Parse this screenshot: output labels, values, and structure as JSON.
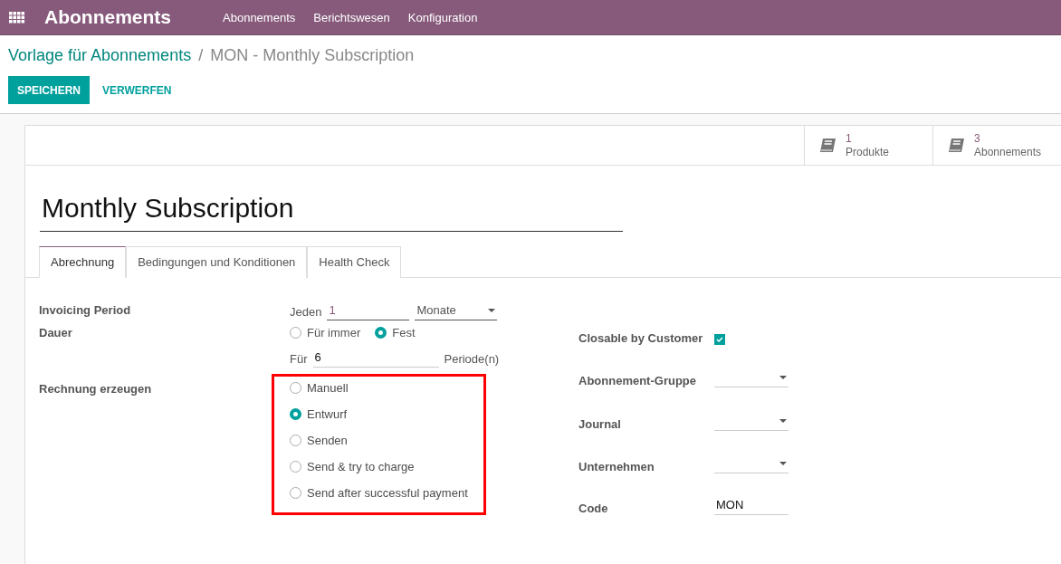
{
  "navbar": {
    "app_title": "Abonnements",
    "menu": [
      "Abonnements",
      "Berichtswesen",
      "Konfiguration"
    ]
  },
  "breadcrumb": {
    "parent": "Vorlage für Abonnements",
    "separator": "/",
    "current": "MON - Monthly Subscription"
  },
  "buttons": {
    "save": "SPEICHERN",
    "discard": "VERWERFEN"
  },
  "stat_buttons": [
    {
      "value": "1",
      "label": "Produkte"
    },
    {
      "value": "3",
      "label": "Abonnements"
    }
  ],
  "title": "Monthly Subscription",
  "tabs": [
    {
      "label": "Abrechnung",
      "selected": true
    },
    {
      "label": "Bedingungen und Konditionen",
      "selected": false
    },
    {
      "label": "Health Check",
      "selected": false
    }
  ],
  "invoicing_period": {
    "label": "Invoicing Period",
    "prefix": "Jeden",
    "value": "1",
    "unit": "Monate"
  },
  "duration": {
    "label": "Dauer",
    "options": [
      {
        "label": "Für immer",
        "selected": false
      },
      {
        "label": "Fest",
        "selected": true
      }
    ],
    "for_prefix": "Für",
    "for_value": "6",
    "suffix": "Periode(n)"
  },
  "invoice_creation": {
    "label": "Rechnung erzeugen",
    "highlighted": true,
    "options": [
      {
        "label": "Manuell",
        "selected": false
      },
      {
        "label": "Entwurf",
        "selected": true
      },
      {
        "label": "Senden",
        "selected": false
      },
      {
        "label": "Send & try to charge",
        "selected": false
      },
      {
        "label": "Send after successful payment",
        "selected": false
      }
    ]
  },
  "right_fields": [
    {
      "label": "Closable by Customer",
      "kind": "checkbox",
      "checked": true
    },
    {
      "label": "Abonnement-Gruppe",
      "kind": "select"
    },
    {
      "label": "Journal",
      "kind": "select"
    },
    {
      "label": "Unternehmen",
      "kind": "select"
    },
    {
      "label": "Code",
      "kind": "text",
      "value": "MON"
    }
  ]
}
